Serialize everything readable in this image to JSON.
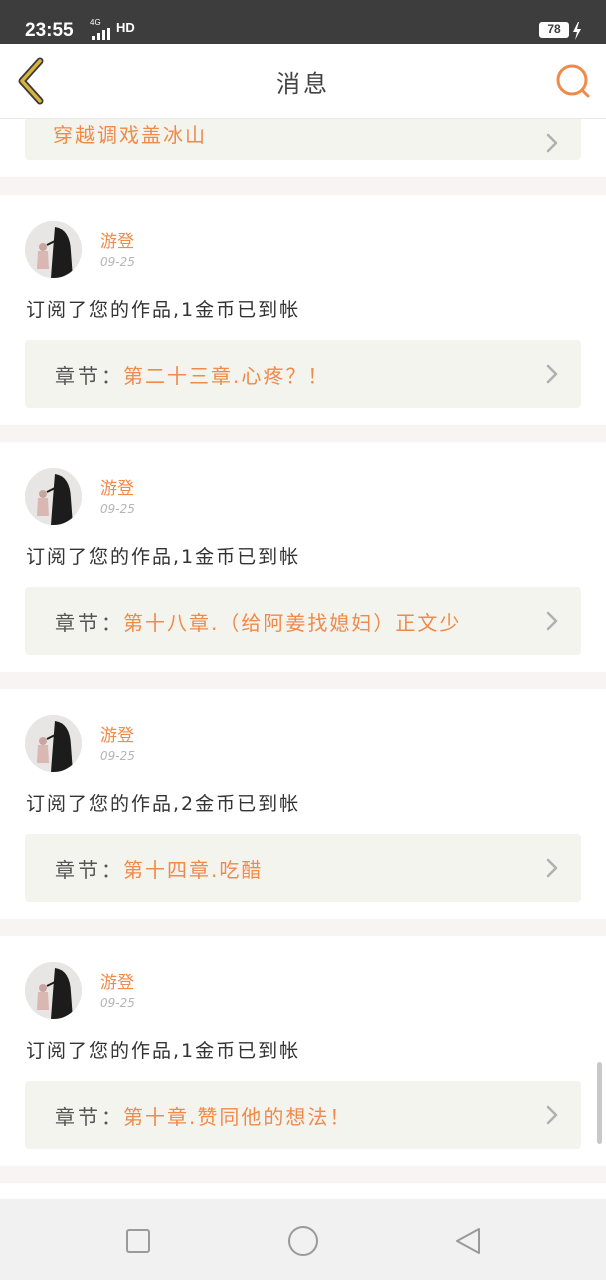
{
  "status_bar": {
    "time": "23:55",
    "network": "4G",
    "hd": "HD",
    "battery": "78"
  },
  "header": {
    "title": "消息"
  },
  "partial_item": {
    "chapter_title": "穿越调戏盖冰山"
  },
  "messages": [
    {
      "username": "游登",
      "date": "09-25",
      "text": "订阅了您的作品,1金币已到帐",
      "chapter_prefix": "章节：",
      "chapter_title": "第二十三章.心疼？！"
    },
    {
      "username": "游登",
      "date": "09-25",
      "text": "订阅了您的作品,1金币已到帐",
      "chapter_prefix": "章节：",
      "chapter_title": "第十八章.（给阿姜找媳妇）正文少"
    },
    {
      "username": "游登",
      "date": "09-25",
      "text": "订阅了您的作品,2金币已到帐",
      "chapter_prefix": "章节：",
      "chapter_title": "第十四章.吃醋"
    },
    {
      "username": "游登",
      "date": "09-25",
      "text": "订阅了您的作品,1金币已到帐",
      "chapter_prefix": "章节：",
      "chapter_title": "第十章.赞同他的想法！"
    }
  ],
  "colors": {
    "accent": "#f08a4a",
    "back_icon": "#c9a227",
    "chapter_bg": "#f4f4ee",
    "page_bg": "#f7f4f3"
  },
  "icons": {
    "back": "chevron-left-icon",
    "search": "search-icon",
    "chevron": "chevron-right-icon",
    "nav_recent": "square-icon",
    "nav_home": "circle-icon",
    "nav_back": "triangle-back-icon"
  }
}
